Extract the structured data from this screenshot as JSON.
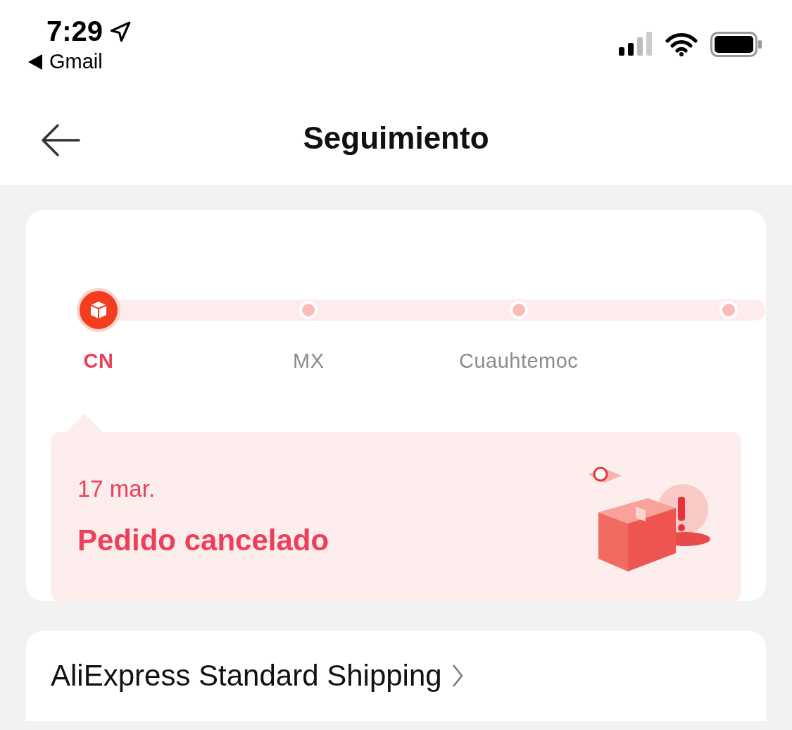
{
  "status_bar": {
    "time": "7:29",
    "back_app": "Gmail"
  },
  "header": {
    "title": "Seguimiento"
  },
  "tracking": {
    "steps": [
      {
        "label": "CN",
        "selected": true
      },
      {
        "label": "MX",
        "selected": false
      },
      {
        "label": "Cuauhtemoc",
        "selected": false
      },
      {
        "selected": false
      }
    ],
    "event": {
      "date": "17 mar.",
      "status": "Pedido cancelado"
    }
  },
  "shipping": {
    "method": "AliExpress Standard Shipping"
  }
}
